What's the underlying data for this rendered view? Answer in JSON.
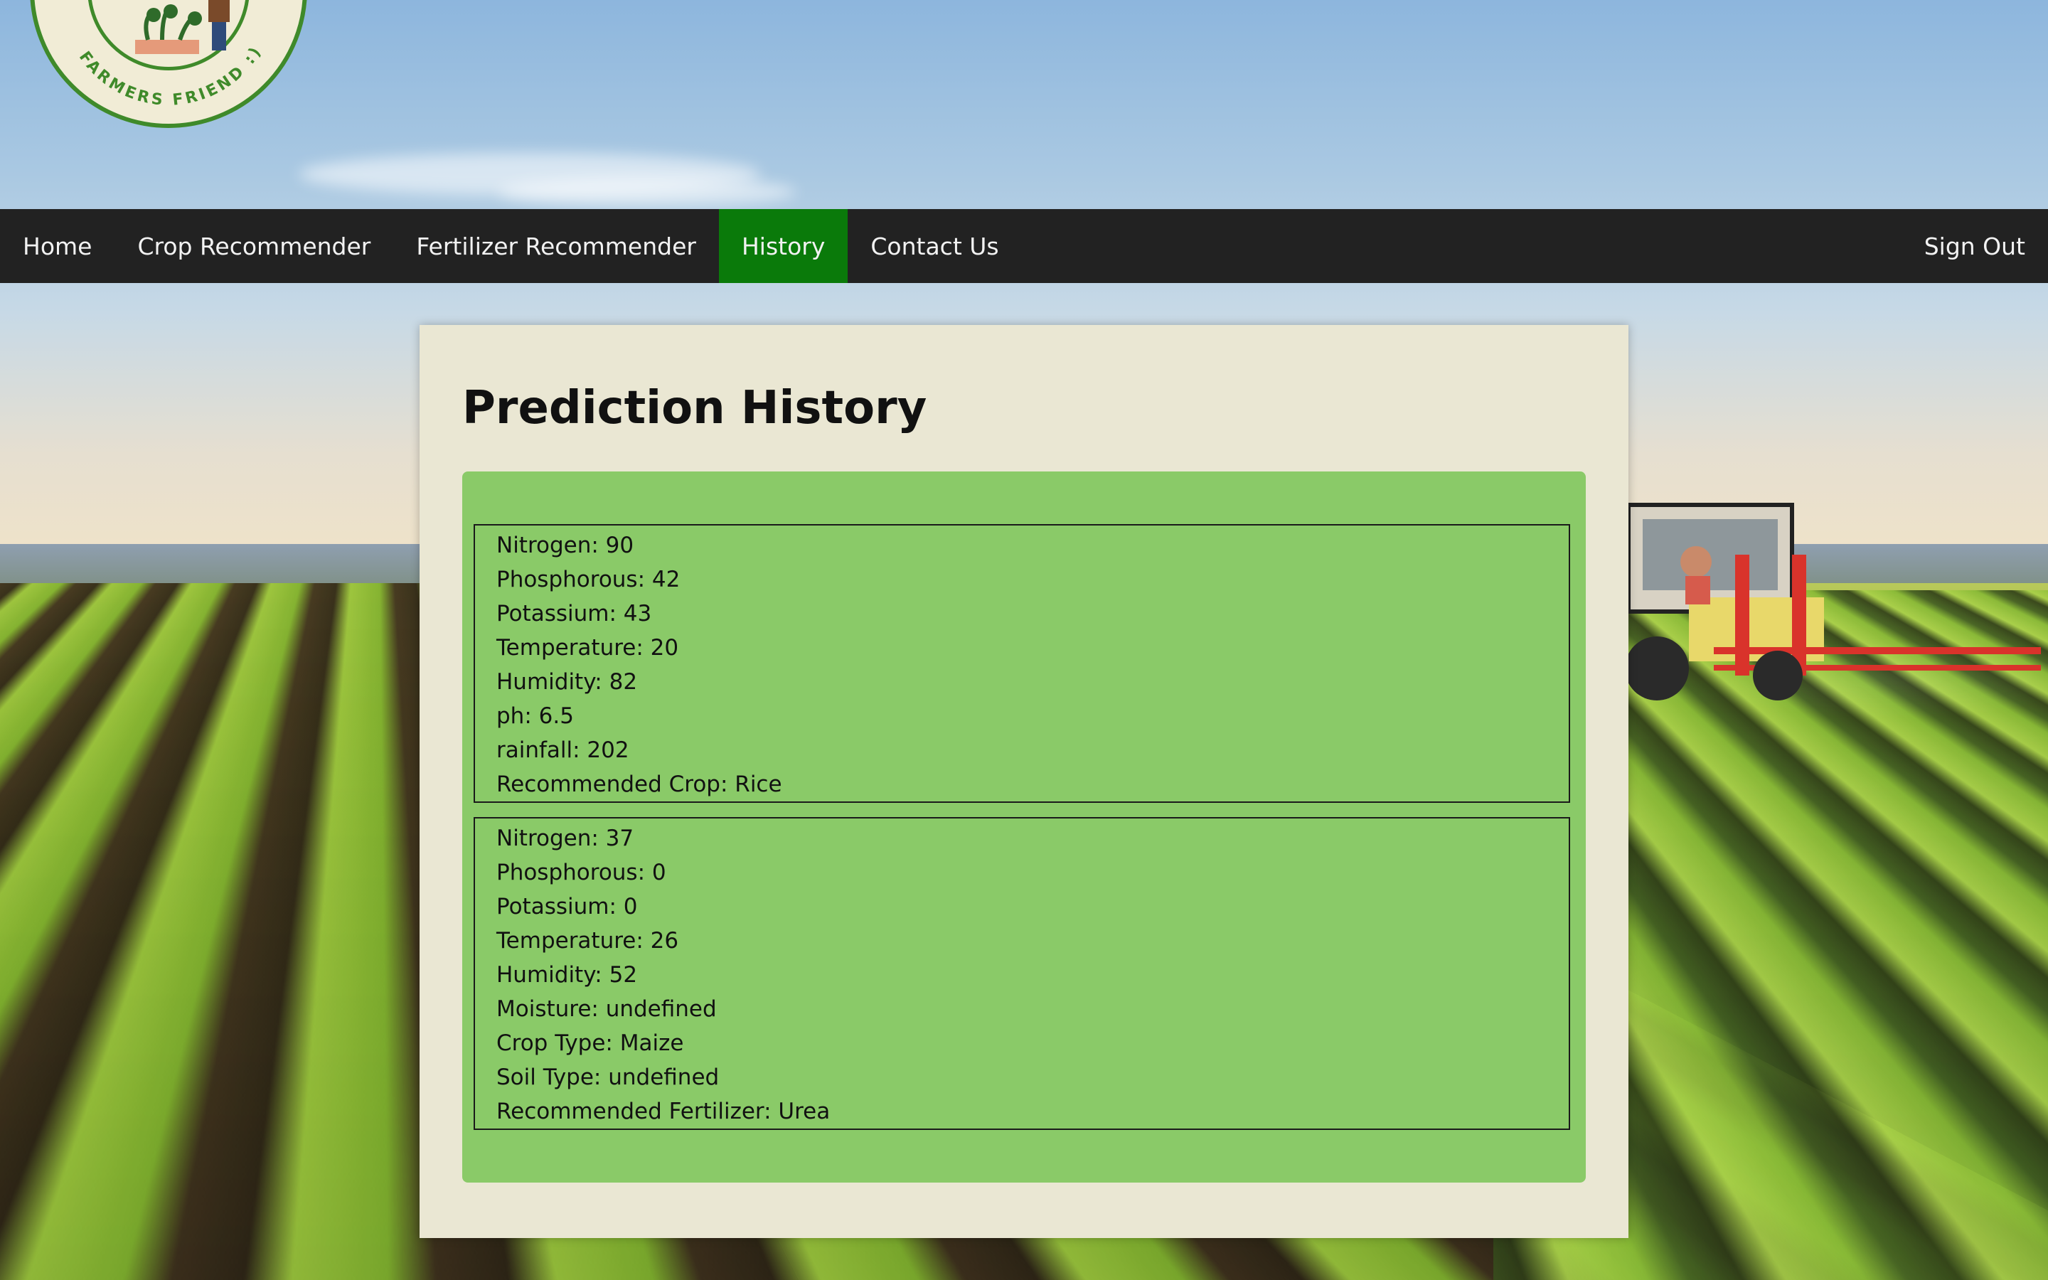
{
  "header": {
    "logo_text": "FARMERS FRIEND :)"
  },
  "nav": {
    "items": [
      {
        "label": "Home"
      },
      {
        "label": "Crop Recommender"
      },
      {
        "label": "Fertilizer Recommender"
      },
      {
        "label": "History"
      },
      {
        "label": "Contact Us"
      }
    ],
    "active": "History",
    "sign_out": "Sign Out"
  },
  "history": {
    "title": "Prediction History",
    "entries": [
      {
        "lines": [
          "Nitrogen: 90",
          "Phosphorous: 42",
          "Potassium: 43",
          "Temperature: 20",
          "Humidity: 82",
          "ph: 6.5",
          "rainfall: 202",
          "Recommended Crop: Rice"
        ]
      },
      {
        "lines": [
          "Nitrogen: 37",
          "Phosphorous: 0",
          "Potassium: 0",
          "Temperature: 26",
          "Humidity: 52",
          "Moisture: undefined",
          "Crop Type: Maize",
          "Soil Type: undefined",
          "Recommended Fertilizer: Urea"
        ]
      }
    ]
  },
  "colors": {
    "nav_bg": "#222222",
    "nav_active": "#0a7a0a",
    "card_bg": "#eae7d3",
    "panel_bg": "#8aca68",
    "brand_green": "#3f8a2a"
  }
}
